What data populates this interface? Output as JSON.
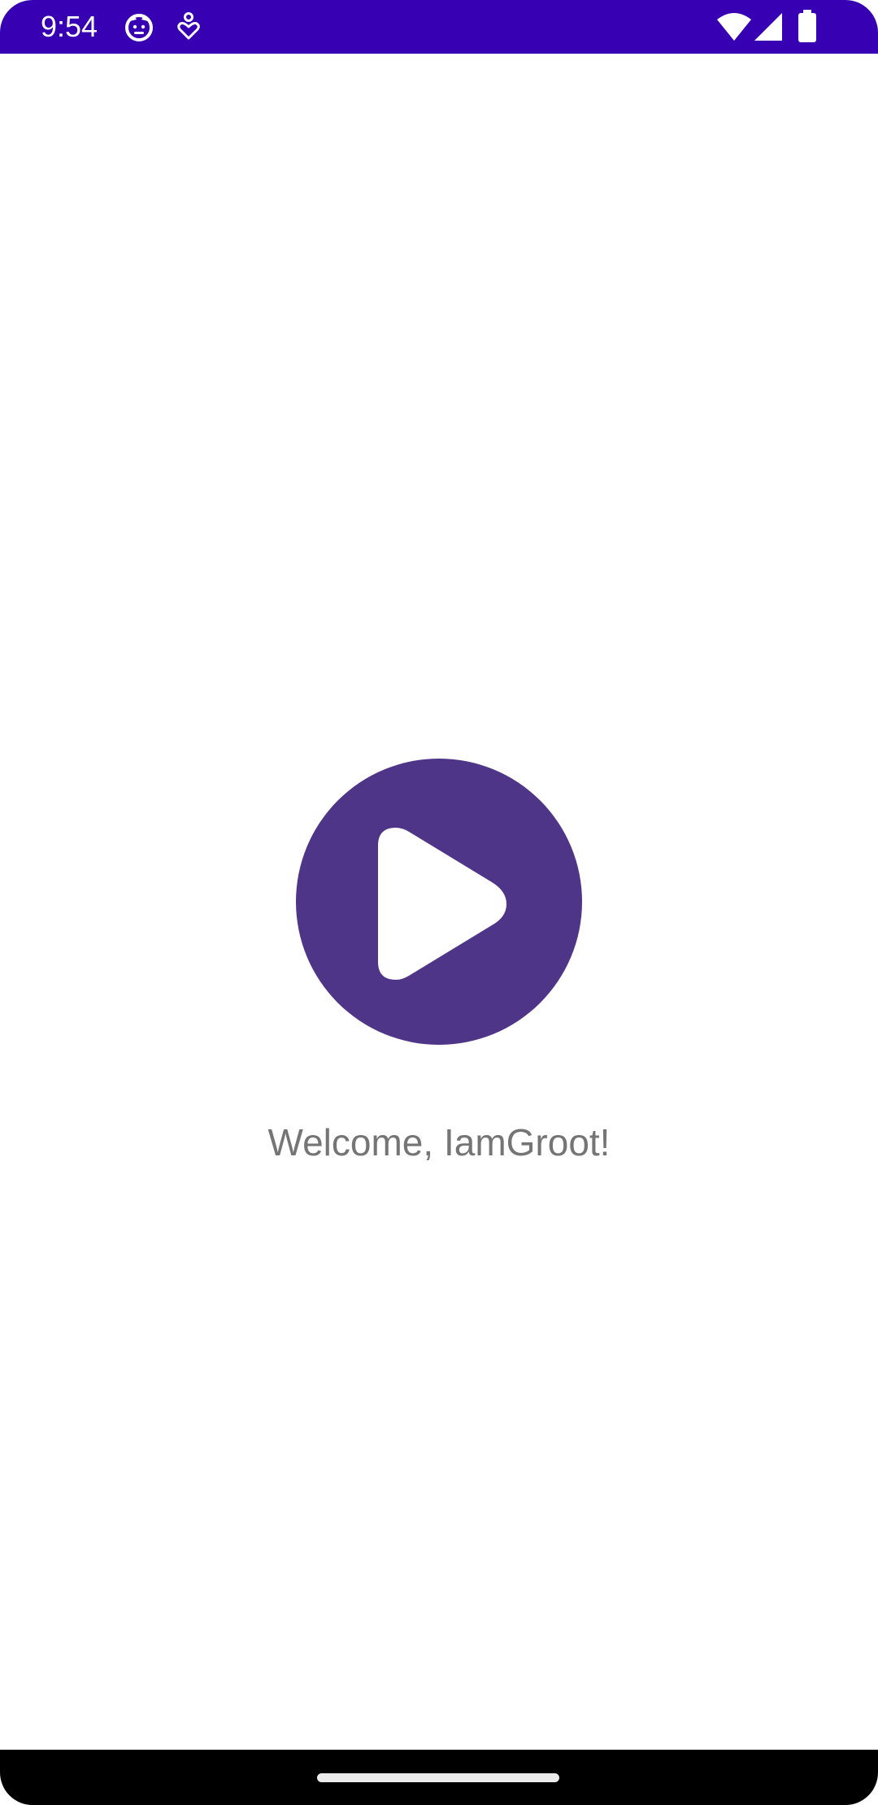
{
  "status_bar": {
    "time": "9:54",
    "background_color": "#3700b3",
    "notification_icons": [
      "face-notification-icon",
      "accessibility-notification-icon"
    ],
    "system_icons": [
      "wifi-icon",
      "cellular-signal-icon",
      "battery-icon"
    ]
  },
  "main": {
    "logo_icon": "play-circle-icon",
    "logo_color": "#4f3587",
    "welcome_text": "Welcome, IamGroot!"
  },
  "nav_bar": {
    "gesture": "home-gesture-handle"
  }
}
